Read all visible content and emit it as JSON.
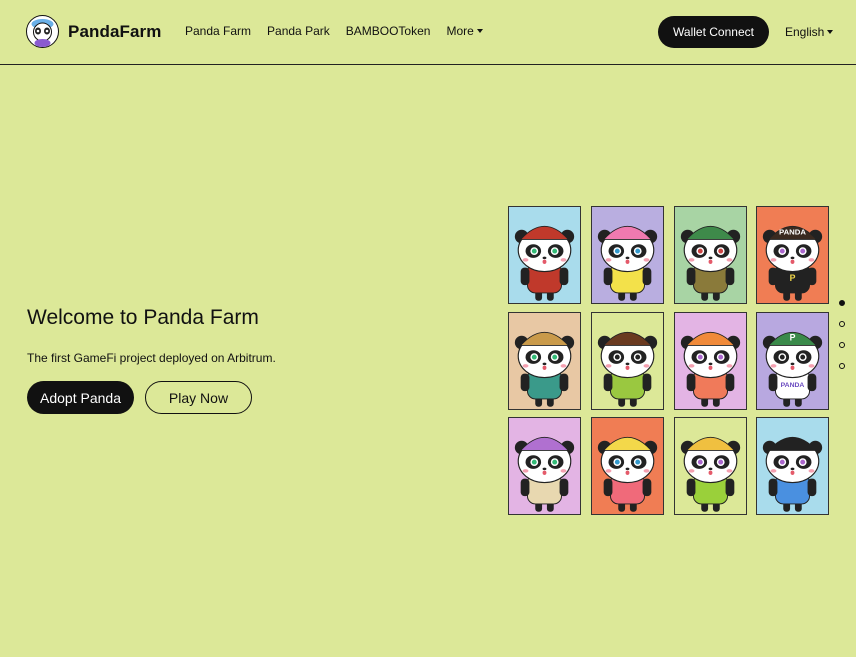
{
  "header": {
    "brand": "PandaFarm",
    "nav": [
      "Panda Farm",
      "Panda Park",
      "BAMBOOToken"
    ],
    "more_label": "More",
    "wallet_label": "Wallet Connect",
    "language": "English"
  },
  "hero": {
    "title": "Welcome to Panda Farm",
    "subtitle": "The first GameFi project deployed on Arbitrum.",
    "adopt_label": "Adopt Panda",
    "play_label": "Play Now"
  },
  "pandas": [
    {
      "bg": "#a9dcec",
      "hat": "#c0392b",
      "shirt": "#c0392b",
      "eye": "#3b7"
    },
    {
      "bg": "#b9aee0",
      "hat": "#f07ab0",
      "shirt": "#f3e14a",
      "eye": "#39c"
    },
    {
      "bg": "#a8d4a4",
      "hat": "#3e8a4a",
      "shirt": "#8a7a3a",
      "eye": "#c44"
    },
    {
      "bg": "#f07d54",
      "hat": "#3a2a20",
      "shirt": "#222222",
      "eye": "#a6c",
      "hat_text": "PANDA",
      "shirt_text": "P"
    },
    {
      "bg": "#e8c8a4",
      "hat": "#c99a4a",
      "shirt": "#3a9a8a",
      "eye": "#3b7"
    },
    {
      "bg": "#dce898",
      "hat": "#6a3a20",
      "shirt": "#9ac840",
      "eye": "#222"
    },
    {
      "bg": "#e3b4e4",
      "hat": "#f08a3a",
      "shirt": "#f07a5a",
      "eye": "#a6c"
    },
    {
      "bg": "#b8a8e0",
      "hat": "#3a8a4a",
      "shirt": "#ffffff",
      "eye": "#222",
      "hat_text": "P",
      "shirt_text": "PANDA"
    },
    {
      "bg": "#e3b4e4",
      "hat": "#b070d0",
      "shirt": "#e8d8b0",
      "eye": "#3b7"
    },
    {
      "bg": "#f07d54",
      "hat": "#f3d84a",
      "shirt": "#f06a7a",
      "eye": "#39c"
    },
    {
      "bg": "#dce898",
      "hat": "#f0c040",
      "shirt": "#9ad03a",
      "eye": "#a6c"
    },
    {
      "bg": "#a9dcec",
      "hat": "#222222",
      "shirt": "#4a90e0",
      "eye": "#a6c"
    }
  ],
  "slides": 4,
  "active_slide": 0
}
